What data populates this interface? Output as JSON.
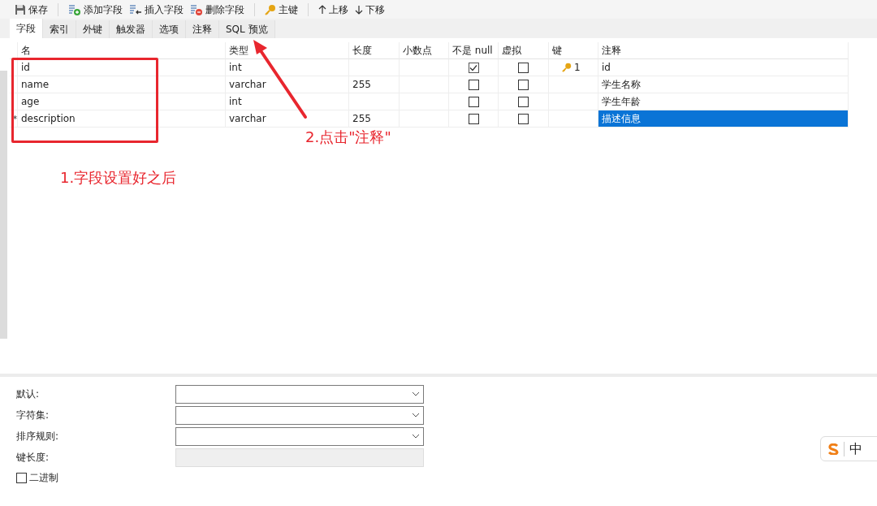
{
  "toolbar": [
    {
      "kind": "save",
      "label": "保存",
      "separator_after": true
    },
    {
      "kind": "add",
      "label": "添加字段",
      "separator_after": false
    },
    {
      "kind": "insert",
      "label": "插入字段",
      "separator_after": false
    },
    {
      "kind": "delete",
      "label": "删除字段",
      "separator_after": true
    },
    {
      "kind": "key",
      "label": "主键",
      "separator_after": true
    },
    {
      "kind": "up",
      "label": "上移",
      "separator_after": false
    },
    {
      "kind": "down",
      "label": "下移",
      "separator_after": false
    }
  ],
  "tabs": [
    {
      "label": "字段",
      "selected": true
    },
    {
      "label": "索引",
      "selected": false
    },
    {
      "label": "外键",
      "selected": false
    },
    {
      "label": "触发器",
      "selected": false
    },
    {
      "label": "选项",
      "selected": false
    },
    {
      "label": "注释",
      "selected": false
    },
    {
      "label": "SQL 预览",
      "selected": false
    }
  ],
  "table": {
    "columns": [
      "名",
      "类型",
      "长度",
      "小数点",
      "不是 null",
      "虚拟",
      "键",
      "注释"
    ],
    "rows": [
      {
        "marker": "",
        "name": "id",
        "type": "int",
        "length": "",
        "decimals": "",
        "not_null": true,
        "virtual": false,
        "key": "1",
        "comment": "id",
        "selected": false
      },
      {
        "marker": "",
        "name": "name",
        "type": "varchar",
        "length": "255",
        "decimals": "",
        "not_null": false,
        "virtual": false,
        "key": "",
        "comment": "学生名称",
        "selected": false
      },
      {
        "marker": "",
        "name": "age",
        "type": "int",
        "length": "",
        "decimals": "",
        "not_null": false,
        "virtual": false,
        "key": "",
        "comment": "学生年龄",
        "selected": false
      },
      {
        "marker": "*",
        "name": "description",
        "type": "varchar",
        "length": "255",
        "decimals": "",
        "not_null": false,
        "virtual": false,
        "key": "",
        "comment": "描述信息",
        "selected": true
      }
    ]
  },
  "properties": [
    {
      "label": "默认:",
      "kind": "dropdown",
      "disabled": false
    },
    {
      "label": "字符集:",
      "kind": "dropdown",
      "disabled": false
    },
    {
      "label": "排序规则:",
      "kind": "dropdown",
      "disabled": false
    },
    {
      "label": "键长度:",
      "kind": "text",
      "disabled": true
    }
  ],
  "binary": {
    "label": "二进制",
    "checked": false
  },
  "annotations": {
    "step_1": "1.字段设置好之后",
    "step_2": "2.点击\"注释\""
  },
  "ime_bar": {
    "mode": "中"
  }
}
